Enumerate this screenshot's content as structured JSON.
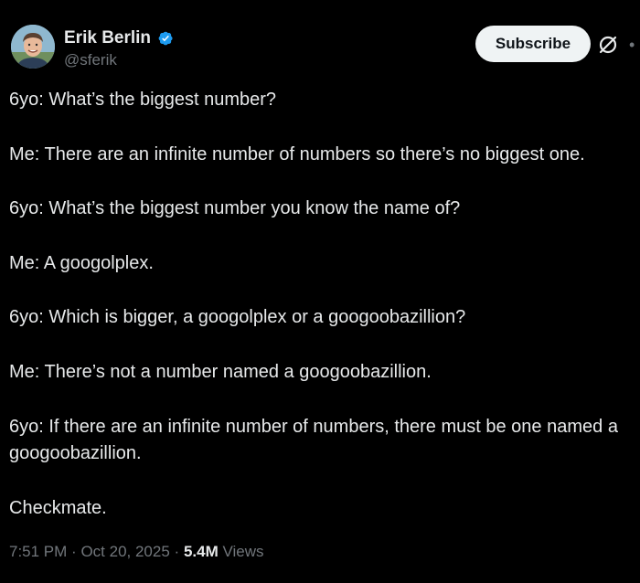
{
  "author": {
    "display_name": "Erik Berlin",
    "handle": "@sferik",
    "verified_color": "#1d9bf0"
  },
  "header": {
    "subscribe_label": "Subscribe",
    "ai_icon": "grok-icon",
    "more_icon": "more-dots-icon"
  },
  "post": {
    "lines": [
      "6yo: What’s the biggest number?",
      "Me: There are an infinite number of numbers so there’s no biggest one.",
      "6yo: What’s the biggest number you know the name of?",
      "Me: A googolplex.",
      "6yo: Which is bigger, a googolplex or a googoobazillion?",
      "Me: There’s not a number named a googoobazillion.",
      "6yo: If there are an infinite number of numbers, there must be one named a googoobazillion.",
      "Checkmate."
    ]
  },
  "meta": {
    "time": "7:51 PM",
    "separator": "·",
    "date": "Oct 20, 2025",
    "views_count": "5.4M",
    "views_label": "Views"
  },
  "colors": {
    "background": "#000000",
    "text": "#e7e9ea",
    "secondary": "#71767b",
    "button_bg": "#eff3f4"
  }
}
